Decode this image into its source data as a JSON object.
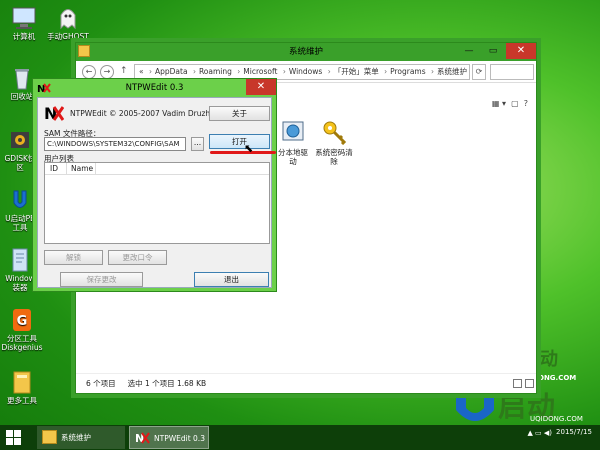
{
  "desktop": {
    "icons": [
      {
        "label": "计算机"
      },
      {
        "label": "手动GHOST"
      },
      {
        "label": "回收站"
      },
      {
        "label": "GDISK快"
      },
      {
        "label": "区"
      },
      {
        "label": "U启动PE"
      },
      {
        "label": "工具"
      },
      {
        "label": "Window"
      },
      {
        "label": "装器"
      },
      {
        "label": "分区工具"
      },
      {
        "label": "Diskgenius"
      },
      {
        "label": "更多工具"
      }
    ]
  },
  "explorer": {
    "title": "系统维护",
    "address": {
      "lead": "«",
      "crumbs": [
        "AppData",
        "Roaming",
        "Microsoft",
        "Windows",
        "「开始」菜单",
        "Programs",
        "系统维护"
      ]
    },
    "items": [
      {
        "label": "分本地驱",
        "label2": "动"
      },
      {
        "label": "系统密码清",
        "label2": "除"
      }
    ],
    "status": {
      "count": "6 个项目",
      "selected": "选中 1 个项目  1.68 KB"
    }
  },
  "dialog": {
    "title": "NTPWEdit 0.3",
    "copyright": "NTPWEdit © 2005-2007 Vadim Druzhin",
    "about_label": "关于",
    "sam_label": "SAM 文件路径：",
    "sam_path": "C:\\WINDOWS\\SYSTEM32\\CONFIG\\SAM",
    "browse_label": "...",
    "open_label": "打开",
    "users_label": "用户列表",
    "columns": [
      "ID",
      "Name"
    ],
    "unlock_label": "解锁",
    "change_pwd_label": "更改口令",
    "save_label": "保存更改",
    "exit_label": "退出"
  },
  "taskbar": {
    "items": [
      {
        "label": "系统维护"
      },
      {
        "label": "NTPWEdit 0.3"
      }
    ],
    "time": "",
    "date": "2015/7/15"
  },
  "watermark": {
    "text1": "动",
    "text2": "ONG.COM",
    "big": "启动",
    "url": "UQIDONG.COM"
  },
  "colors": {
    "title_active": "#3aa02a",
    "close_red": "#c8372a",
    "annotation_red": "#e01818",
    "taskbar": "#0d3f09"
  }
}
